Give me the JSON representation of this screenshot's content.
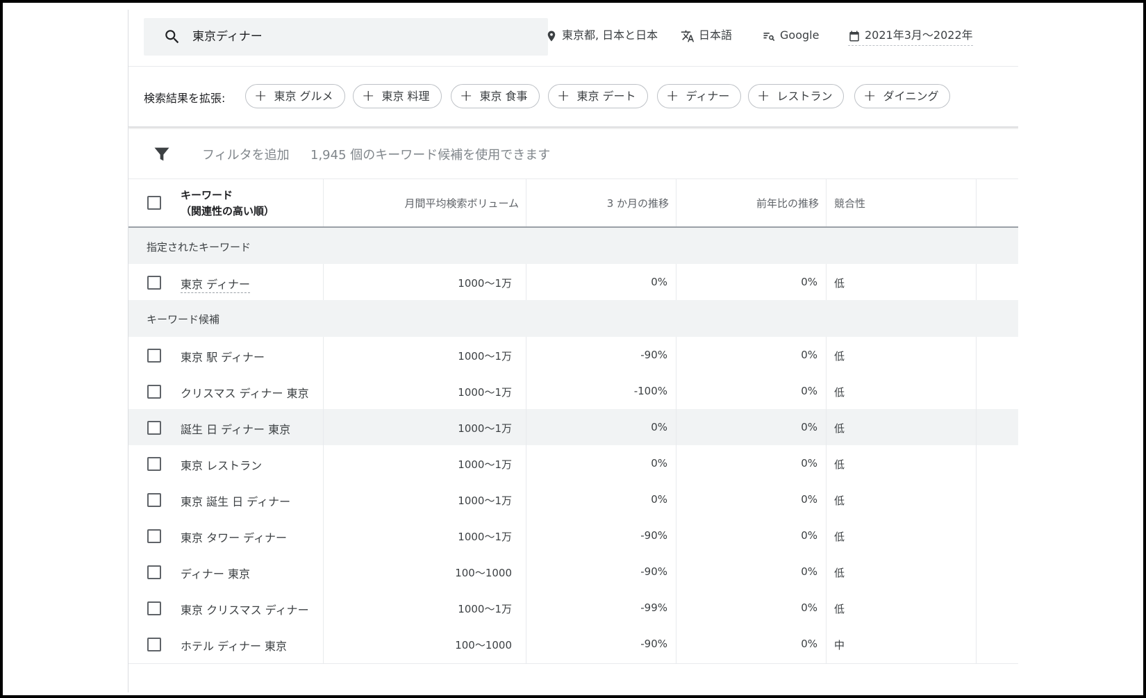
{
  "search": {
    "query": "東京ディナー"
  },
  "toolbar": {
    "location": "東京都, 日本と日本",
    "language": "日本語",
    "network": "Google",
    "date_range": "2021年3月〜2022年2月"
  },
  "expand": {
    "label": "検索結果を拡張:",
    "chips": [
      "東京 グルメ",
      "東京 料理",
      "東京 食事",
      "東京 デート",
      "ディナー",
      "レストラン",
      "ダイニング"
    ]
  },
  "filter": {
    "add_label": "フィルタを追加",
    "count_text": "1,945 個のキーワード候補を使用できます"
  },
  "table": {
    "headers": {
      "keyword_line1": "キーワード",
      "keyword_line2": "（関連性の高い順）",
      "volume": "月間平均検索ボリューム",
      "three_month": "3 か月の推移",
      "yoy": "前年比の推移",
      "competition": "競合性"
    },
    "groups": {
      "provided": "指定されたキーワード",
      "ideas": "キーワード候補"
    },
    "provided_rows": [
      {
        "keyword": "東京 ディナー",
        "volume": "1000〜1万",
        "three_month": "0%",
        "yoy": "0%",
        "competition": "低"
      }
    ],
    "idea_rows": [
      {
        "keyword": "東京 駅 ディナー",
        "volume": "1000〜1万",
        "three_month": "-90%",
        "yoy": "0%",
        "competition": "低"
      },
      {
        "keyword": "クリスマス ディナー 東京",
        "volume": "1000〜1万",
        "three_month": "-100%",
        "yoy": "0%",
        "competition": "低"
      },
      {
        "keyword": "誕生 日 ディナー 東京",
        "volume": "1000〜1万",
        "three_month": "0%",
        "yoy": "0%",
        "competition": "低"
      },
      {
        "keyword": "東京 レストラン",
        "volume": "1000〜1万",
        "three_month": "0%",
        "yoy": "0%",
        "competition": "低"
      },
      {
        "keyword": "東京 誕生 日 ディナー",
        "volume": "1000〜1万",
        "three_month": "0%",
        "yoy": "0%",
        "competition": "低"
      },
      {
        "keyword": "東京 タワー ディナー",
        "volume": "1000〜1万",
        "three_month": "-90%",
        "yoy": "0%",
        "competition": "低"
      },
      {
        "keyword": "ディナー 東京",
        "volume": "100〜1000",
        "three_month": "-90%",
        "yoy": "0%",
        "competition": "低"
      },
      {
        "keyword": "東京 クリスマス ディナー",
        "volume": "1000〜1万",
        "three_month": "-99%",
        "yoy": "0%",
        "competition": "低"
      },
      {
        "keyword": "ホテル ディナー 東京",
        "volume": "100〜1000",
        "three_month": "-90%",
        "yoy": "0%",
        "competition": "中"
      }
    ]
  },
  "colors": {
    "row_highlight": "#f1f3f4",
    "group_bg": "#f1f3f4",
    "text": "#3c4043",
    "muted": "#80868b"
  },
  "icons": [
    "search-icon",
    "location-pin-icon",
    "translate-icon",
    "search-network-icon",
    "calendar-icon",
    "plus-icon",
    "filter-icon",
    "checkbox"
  ]
}
